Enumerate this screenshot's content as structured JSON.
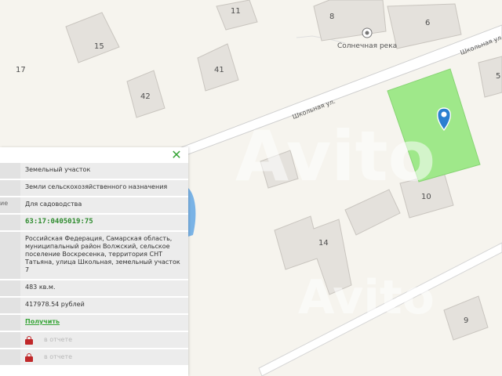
{
  "map": {
    "house_numbers": [
      "11",
      "8",
      "6",
      "15",
      "17",
      "41",
      "42",
      "5",
      "10",
      "14",
      "9"
    ],
    "street_label_1": "Школьная ул.",
    "street_label_2": "Школьная ул.",
    "poi_label": "Солнечная река",
    "watermark_1": "Avito",
    "watermark_2": "Avito",
    "parcel_color": "#9fe88a",
    "marker_color": "#2a7fd0",
    "icons": {
      "poi": "poi-circle-icon",
      "marker": "location-marker-icon"
    }
  },
  "panel": {
    "close_label": "✕",
    "rows": [
      {
        "key": "",
        "value": "Земельный участок"
      },
      {
        "key": "",
        "value": "Земли сельскохозяйственного назначения"
      },
      {
        "key": "ие",
        "value": "Для садоводства"
      },
      {
        "key": "",
        "value": "63:17:0405019:75"
      },
      {
        "key": "",
        "value": "Российская Федерация, Самарская область, муниципальный район Волжский, сельское поселение Воскресенка, территория СНТ Татьяна, улица Школьная, земельный участок 7"
      },
      {
        "key": "",
        "value": "483 кв.м."
      },
      {
        "key": "",
        "value": "417978.54 рублей"
      },
      {
        "key": "",
        "value": "Получить"
      },
      {
        "key": "",
        "value": "в отчете"
      },
      {
        "key": "",
        "value": "в отчете"
      }
    ],
    "accent_color": "#3aa63a",
    "lock_color": "#c0282a"
  }
}
